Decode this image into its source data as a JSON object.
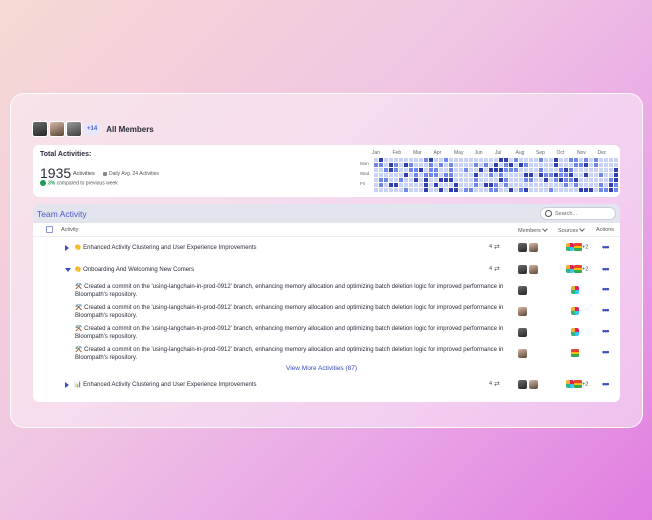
{
  "members": {
    "extra_count": "+14",
    "title": "All Members"
  },
  "stats": {
    "label": "Total Activities:",
    "total": "1935",
    "total_unit": "Activities",
    "daily_avg": "Daily Avg. 24  Activities",
    "compare_pct": "3%",
    "compare_text": "compared to previous week",
    "months": [
      "Jan",
      "Feb",
      "Mar",
      "Apr",
      "May",
      "Jun",
      "Jul",
      "Aug",
      "Sep",
      "Oct",
      "Nov",
      "Dec"
    ],
    "days": [
      "Mon",
      "Wed",
      "Fri"
    ]
  },
  "team": {
    "title": "Team Activity",
    "search_placeholder": "Search...",
    "headers": {
      "activity": "Activity",
      "members": "Members",
      "sources": "Sources",
      "actions": "Actions"
    },
    "rows": [
      {
        "title": "👏 Enhanced Activity Clustering and User Experience Improvements",
        "count": "4",
        "sources_extra": "+2"
      },
      {
        "title": "👏 Onboarding And Welcoming New Comers",
        "count": "4",
        "sources_extra": "+2"
      }
    ],
    "commit_text": "⚒️ Created a commit on the 'using-langchain-in-prod-0912' branch, enhancing memory allocation and optimizing batch deletion logic for improved performance in Bloompath's repository.",
    "view_more": "View More Activities (87)",
    "last_row": {
      "title": "📊 Enhanced Activity Clustering and User Experience Improvements",
      "count": "4",
      "sources_extra": "+2"
    }
  },
  "colors": {
    "accent": "#3b4cc0",
    "heat_low": "#c9d3f7",
    "heat_mid": "#6f86ea",
    "heat_high": "#2f3fb0"
  }
}
